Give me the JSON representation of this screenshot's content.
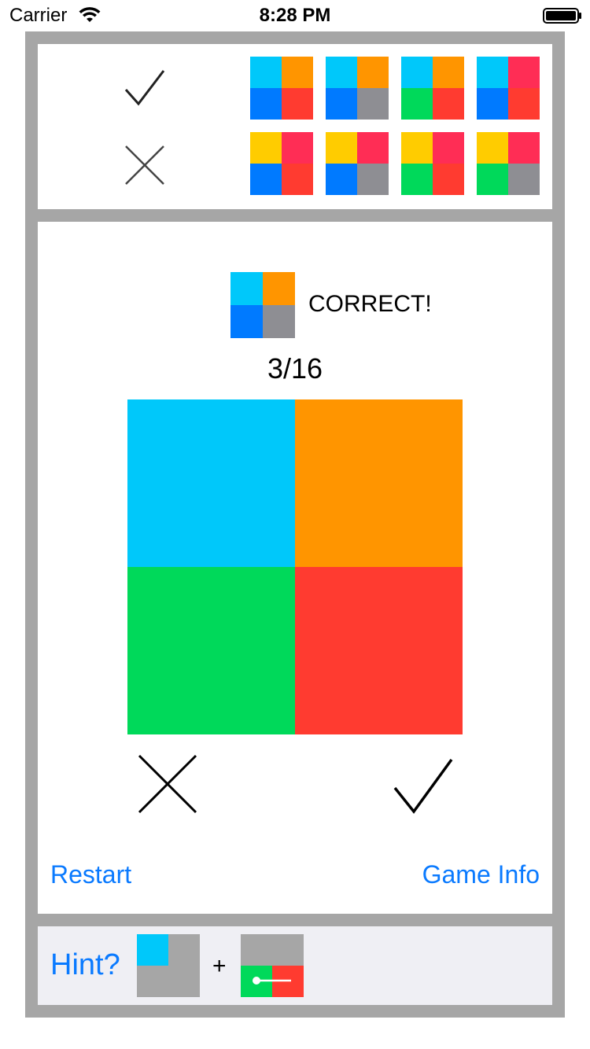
{
  "status_bar": {
    "carrier": "Carrier",
    "time": "8:28 PM"
  },
  "colors": {
    "cyan": "#00c8fa",
    "orange": "#ff9500",
    "blue": "#007aff",
    "red": "#ff3b30",
    "gray": "#8e8e93",
    "green": "#00d95a",
    "yellow": "#ffcc00",
    "pink": "#ff2d55",
    "hint_gray": "#a6a6a6",
    "link_blue": "#0a7aff"
  },
  "legend": {
    "accept_icon": "checkmark-icon",
    "reject_icon": "cross-icon",
    "accepted_patterns": [
      [
        "#00c8fa",
        "#ff9500",
        "#007aff",
        "#ff3b30"
      ],
      [
        "#00c8fa",
        "#ff9500",
        "#007aff",
        "#8e8e93"
      ],
      [
        "#00c8fa",
        "#ff9500",
        "#00d95a",
        "#ff3b30"
      ],
      [
        "#00c8fa",
        "#ff2d55",
        "#007aff",
        "#ff3b30"
      ]
    ],
    "rejected_patterns": [
      [
        "#ffcc00",
        "#ff2d55",
        "#007aff",
        "#ff3b30"
      ],
      [
        "#ffcc00",
        "#ff2d55",
        "#007aff",
        "#8e8e93"
      ],
      [
        "#ffcc00",
        "#ff2d55",
        "#00d95a",
        "#ff3b30"
      ],
      [
        "#ffcc00",
        "#ff2d55",
        "#00d95a",
        "#8e8e93"
      ]
    ]
  },
  "main": {
    "result_pattern": [
      "#00c8fa",
      "#ff9500",
      "#007aff",
      "#8e8e93"
    ],
    "result_text": "CORRECT!",
    "progress": "3/16",
    "current_pattern": [
      "#00c8fa",
      "#ff9500",
      "#00d95a",
      "#ff3b30"
    ],
    "reject_button_icon": "cross-icon",
    "accept_button_icon": "checkmark-icon",
    "restart_label": "Restart",
    "game_info_label": "Game Info"
  },
  "hint": {
    "label": "Hint?",
    "plus": "+",
    "pattern_a": [
      "#00c8fa",
      "#a6a6a6",
      "#a6a6a6",
      "#a6a6a6"
    ],
    "pattern_b": [
      "#a6a6a6",
      "#a6a6a6",
      "#00d95a",
      "#ff3b30"
    ]
  }
}
